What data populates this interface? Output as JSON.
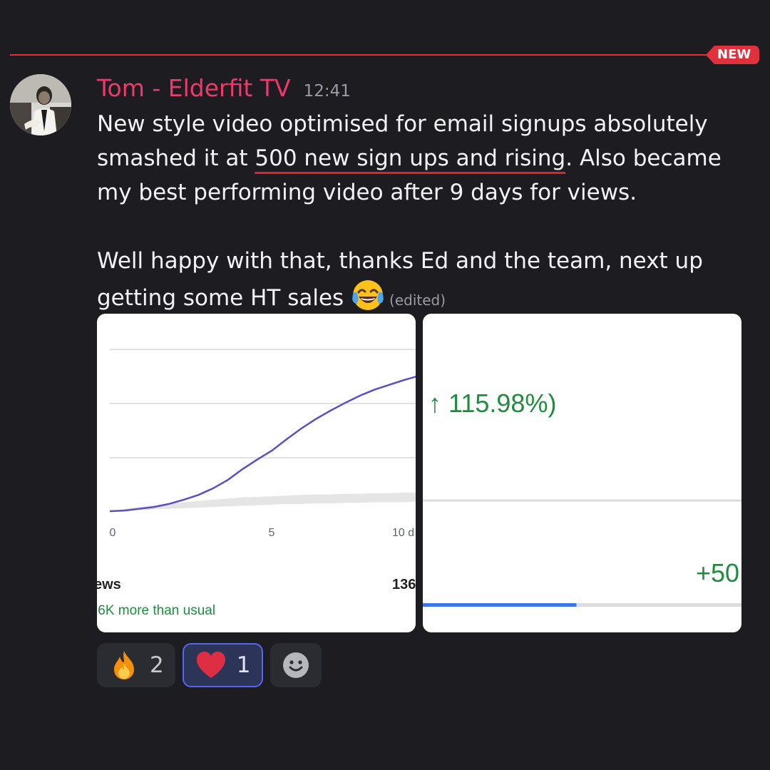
{
  "divider": {
    "badge": "NEW",
    "color": "#e0323c"
  },
  "message": {
    "username": "Tom - Elderfit TV",
    "username_color": "#f0386b",
    "timestamp": "12:41",
    "para1_pre": "New style video optimised for email signups absolutely smashed it at ",
    "para1_underlined": "500 new sign ups and rising",
    "para1_post": ". Also became my best performing video after 9 days for views.",
    "para2": "Well happy with that, thanks Ed and the team, next up getting some HT sales ",
    "emoji": "face-with-tears-of-joy-icon",
    "edited": "(edited)"
  },
  "attachments": {
    "left": {
      "x_ticks": [
        "0",
        "5",
        "10 d"
      ],
      "metric_label": "ews",
      "metric_value": "136",
      "comparison": ".6K more than usual",
      "comparison_color": "#1e8e3e"
    },
    "right": {
      "change": "↑ 115.98%)",
      "delta": "+50",
      "progress_fraction": 0.5,
      "accent_color": "#1e8e3e",
      "bar_color": "#3b78e7"
    }
  },
  "chart_data": {
    "type": "line",
    "x": [
      0,
      0.5,
      1,
      1.5,
      2,
      2.5,
      3,
      3.5,
      4,
      4.5,
      5,
      5.5,
      6,
      6.5,
      7,
      7.5,
      8,
      8.5,
      9,
      9.5,
      10,
      10.5
    ],
    "series": [
      {
        "values": [
          0,
          1,
          4,
          7,
          12,
          19,
          27,
          38,
          52,
          70,
          86,
          101,
          120,
          138,
          154,
          168,
          181,
          193,
          203,
          211,
          219,
          226
        ]
      }
    ],
    "typical_band": {
      "low": [
        0,
        1,
        2,
        3,
        4,
        5,
        6,
        7,
        8,
        9,
        10,
        11,
        12,
        12,
        13,
        13,
        14,
        14,
        15,
        15,
        15,
        16
      ],
      "high": [
        0,
        4,
        7,
        10,
        13,
        15,
        17,
        19,
        21,
        23,
        24,
        25,
        26,
        27,
        28,
        28,
        29,
        29,
        30,
        30,
        31,
        31
      ]
    },
    "xlim": [
      0,
      10.6
    ],
    "ylim": [
      0,
      270
    ],
    "line_color": "#5b4fc6",
    "band_color": "#e5e5e5",
    "grid": true
  },
  "reactions": [
    {
      "icon": "fire-icon",
      "count": "2",
      "active": false
    },
    {
      "icon": "heart-icon",
      "count": "1",
      "active": true
    }
  ],
  "add_reaction": {
    "icon": "smiley-add-reaction-icon"
  }
}
